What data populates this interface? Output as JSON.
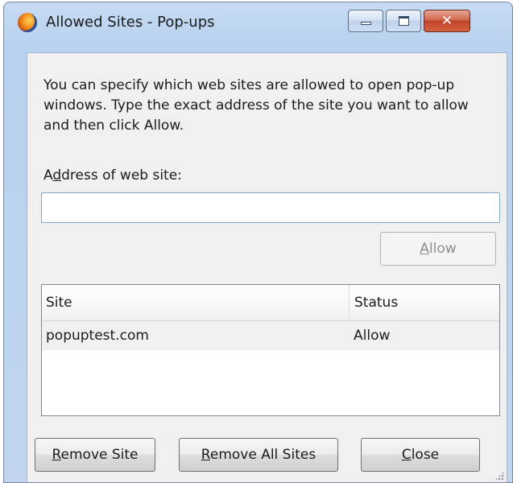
{
  "window": {
    "title": "Allowed Sites - Pop-ups",
    "icon": "firefox-icon",
    "controls": {
      "minimize": "minimize-icon",
      "maximize": "maximize-icon",
      "close_glyph": "✕"
    }
  },
  "dialog": {
    "description": "You can specify which web sites are allowed to open pop-up windows. Type the exact address of the site you want to allow and then click Allow.",
    "address_label_pre": "A",
    "address_label_accel": "d",
    "address_label_post": "dress of web site:",
    "address_value": "",
    "address_placeholder": "",
    "allow_button": {
      "accel": "A",
      "rest": "llow",
      "enabled": false
    }
  },
  "site_list": {
    "columns": [
      "Site",
      "Status"
    ],
    "rows": [
      {
        "site": "popuptest.com",
        "status": "Allow"
      }
    ]
  },
  "buttons": {
    "remove_site": {
      "accel": "R",
      "rest": "emove Site"
    },
    "remove_all_sites": {
      "accel": "R",
      "rest": "emove All Sites"
    },
    "close": {
      "accel": "C",
      "rest": "lose"
    }
  },
  "colors": {
    "frame": "#c6dbf3",
    "client": "#f0f0f0",
    "close_button": "#c0442b",
    "input_border": "#7fa5c9"
  }
}
